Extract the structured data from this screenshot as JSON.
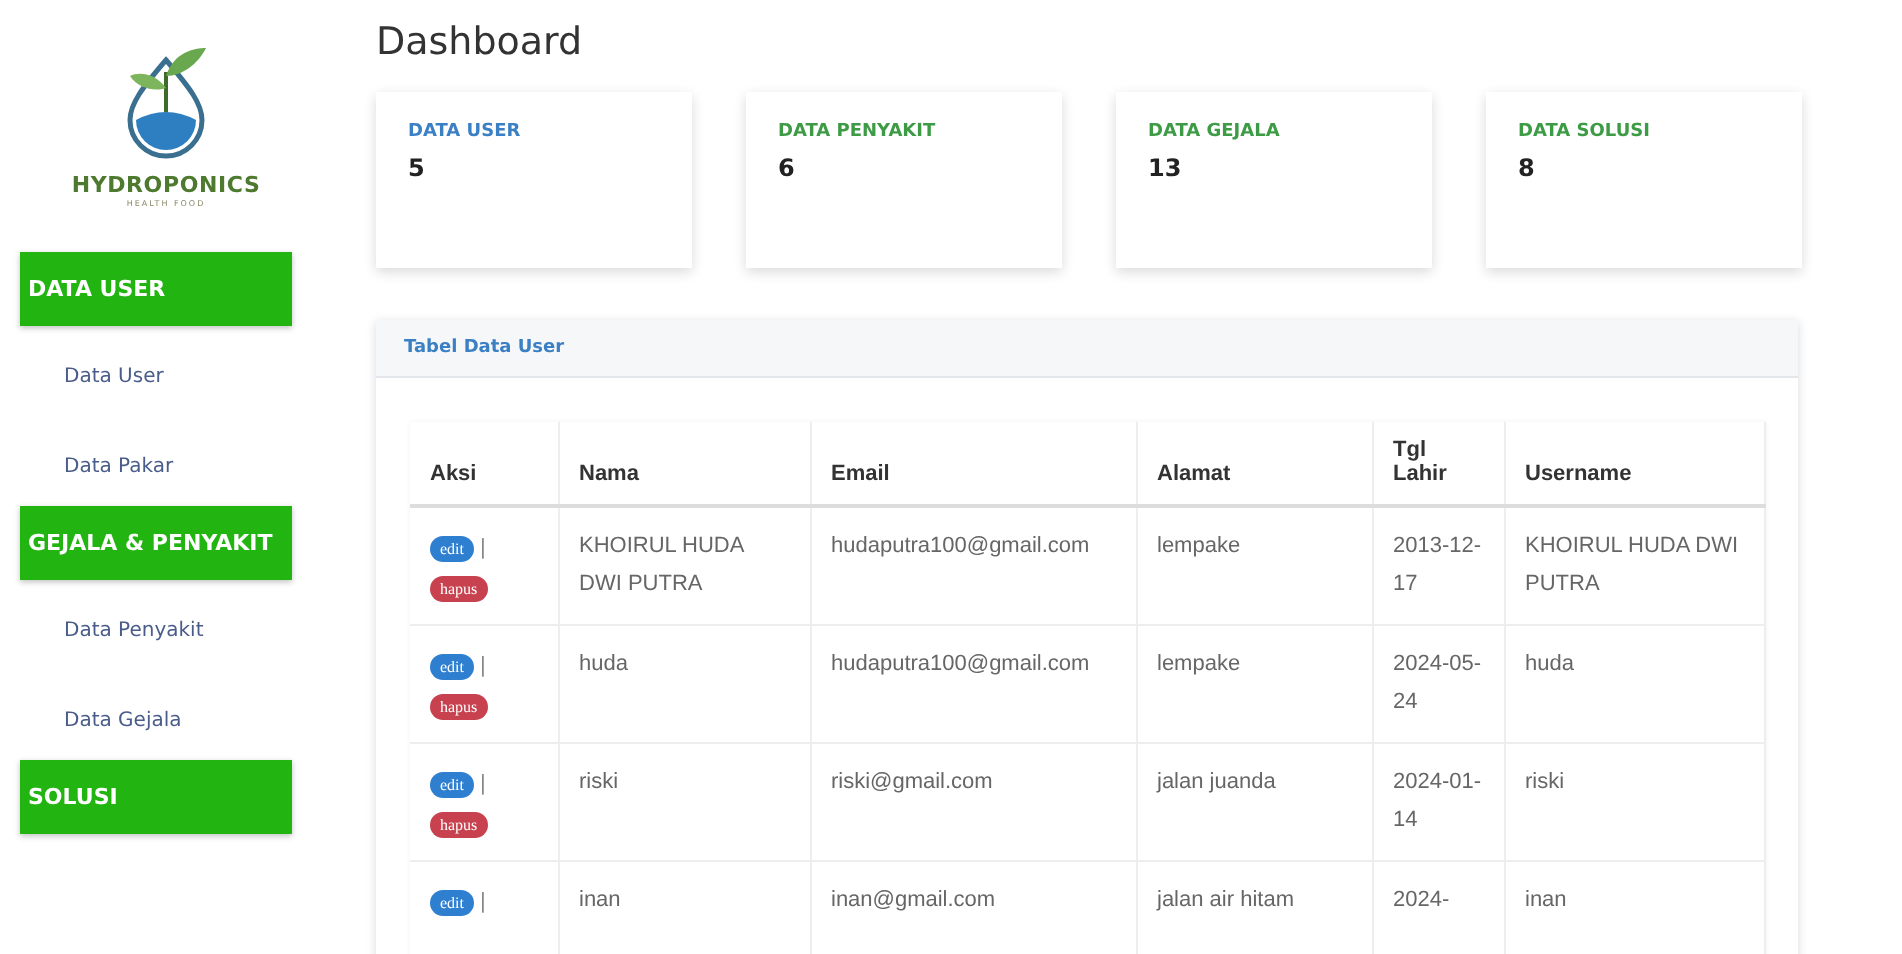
{
  "logo": {
    "title": "HYDROPONICS",
    "subtitle": "HEALTH FOOD"
  },
  "sidebar": {
    "sections": [
      {
        "title": "DATA USER",
        "items": [
          {
            "label": "Data User"
          },
          {
            "label": "Data Pakar"
          }
        ]
      },
      {
        "title": "GEJALA & PENYAKIT",
        "items": [
          {
            "label": "Data Penyakit"
          },
          {
            "label": "Data Gejala"
          }
        ]
      },
      {
        "title": "SOLUSI"
      }
    ]
  },
  "page_title": "Dashboard",
  "stat_cards": [
    {
      "label": "DATA USER",
      "value": "5",
      "color": "#3b7fc4"
    },
    {
      "label": "DATA PENYAKIT",
      "value": "6",
      "color": "#3d9b45"
    },
    {
      "label": "DATA GEJALA",
      "value": "13",
      "color": "#3d9b45"
    },
    {
      "label": "DATA SOLUSI",
      "value": "8",
      "color": "#3d9b45"
    }
  ],
  "table": {
    "title": "Tabel Data User",
    "columns": [
      "Aksi",
      "Nama",
      "Email",
      "Alamat",
      "Tgl Lahir",
      "Username"
    ],
    "rows": [
      {
        "cells": [
          {
            "edit": "edit",
            "separator": "|",
            "delete": "hapus"
          },
          "KHOIRUL HUDA DWI PUTRA",
          "hudaputra100@gmail.com",
          "lempake",
          "2013-12-17",
          "KHOIRUL HUDA DWI PUTRA"
        ]
      },
      {
        "cells": [
          {
            "edit": "edit",
            "separator": "|",
            "delete": "hapus"
          },
          "huda",
          "hudaputra100@gmail.com",
          "lempake",
          "2024-05-24",
          "huda"
        ]
      },
      {
        "cells": [
          {
            "edit": "edit",
            "separator": "|",
            "delete": "hapus"
          },
          "riski",
          "riski@gmail.com",
          "jalan juanda",
          "2024-01-14",
          "riski"
        ]
      },
      {
        "cells": [
          {
            "edit": "edit",
            "separator": "|"
          },
          "inan",
          "inan@gmail.com",
          "jalan air hitam",
          "2024-",
          "inan"
        ]
      }
    ]
  }
}
